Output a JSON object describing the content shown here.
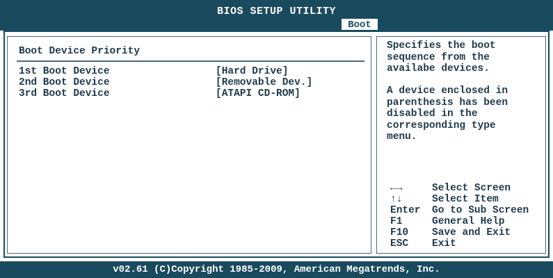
{
  "header": {
    "title": "BIOS SETUP UTILITY",
    "active_tab": "Boot"
  },
  "main": {
    "section_title": "Boot Device Priority",
    "items": [
      {
        "label": "1st Boot Device",
        "value": "[Hard Drive]"
      },
      {
        "label": "2nd Boot Device",
        "value": "[Removable Dev.]"
      },
      {
        "label": "3rd Boot Device",
        "value": "[ATAPI CD-ROM]"
      }
    ]
  },
  "help": {
    "para1": "Specifies the boot\nsequence from the\navailabe devices.",
    "para2": "A device enclosed in\nparenthesis has been\ndisabled in the\ncorresponding type\nmenu."
  },
  "keys": [
    {
      "key": "←→",
      "desc": "Select Screen"
    },
    {
      "key": "↑↓",
      "desc": "Select Item"
    },
    {
      "key": "Enter",
      "desc": "Go to Sub Screen"
    },
    {
      "key": "F1",
      "desc": "General Help"
    },
    {
      "key": "F10",
      "desc": "Save and Exit"
    },
    {
      "key": "ESC",
      "desc": "Exit"
    }
  ],
  "footer": {
    "text": "v02.61 (C)Copyright 1985-2009, American Megatrends, Inc."
  },
  "colors": {
    "bar": "#1a4a5e",
    "text": "#1f3a4a",
    "background": "#ffffff"
  }
}
